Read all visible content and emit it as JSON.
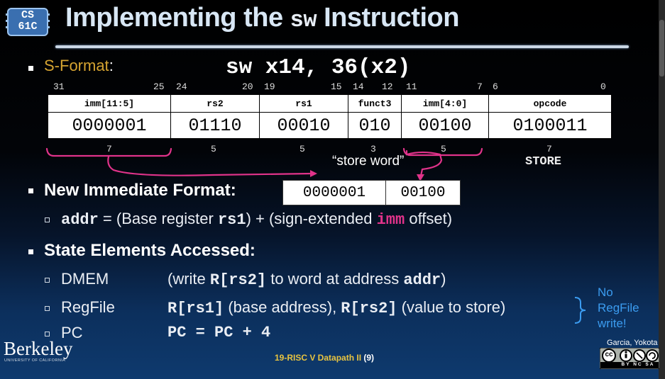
{
  "logo": {
    "line1": "CS",
    "line2": "61C"
  },
  "title": {
    "pre": "Implementing the ",
    "code": "sw",
    "post": " Instruction"
  },
  "sformat": {
    "label": "S-Format",
    "colon": ":",
    "instruction": "sw x14, 36(x2)"
  },
  "bit_positions": [
    "31",
    "25",
    "24",
    "20",
    "19",
    "15",
    "14",
    "12",
    "11",
    "7",
    "6",
    "0"
  ],
  "fields": [
    {
      "name": "imm[11:5]",
      "value": "0000001",
      "width": "7"
    },
    {
      "name": "rs2",
      "value": "01110",
      "width": "5"
    },
    {
      "name": "rs1",
      "value": "00010",
      "width": "5"
    },
    {
      "name": "funct3",
      "value": "010",
      "width": "3"
    },
    {
      "name": "imm[4:0]",
      "value": "00100",
      "width": "5"
    },
    {
      "name": "opcode",
      "value": "0100011",
      "width": "7"
    }
  ],
  "store_word_note": "“store word”",
  "opcode_name": "STORE",
  "new_imm": {
    "heading": "New Immediate Format:",
    "high": "0000001",
    "low": "00100"
  },
  "addr_line": {
    "code1": "addr",
    "eq": " = (Base register ",
    "code2": "rs1",
    "mid": ") + (sign-extended ",
    "code3": "imm",
    "end": " offset)"
  },
  "state_heading": "State Elements Accessed:",
  "state_rows": [
    {
      "name": "DMEM",
      "d1": "(write ",
      "c1": "R[rs2]",
      "d2": " to word at address ",
      "c2": "addr",
      "d3": ")"
    },
    {
      "name": "RegFile",
      "c1": "R[rs1]",
      "d1": " (base address), ",
      "c2": "R[rs2]",
      "d2": " (value to store)"
    },
    {
      "name": "PC",
      "code": "PC = PC + 4"
    }
  ],
  "side_note": "No RegFile write!",
  "footer": {
    "text": "19-RISC V Datapath II ",
    "page": "(9)"
  },
  "berkeley": {
    "name": "Berkeley",
    "sub": "UNIVERSITY OF CALIFORNIA"
  },
  "authors": "Garcia, Yokota",
  "license": {
    "cc": "cc",
    "labels": "BY NC SA"
  },
  "colors": {
    "accent_gold": "#d6a431",
    "pink": "#e0338a",
    "blue_note": "#3b9cf0",
    "footer_gold": "#e8c440"
  }
}
